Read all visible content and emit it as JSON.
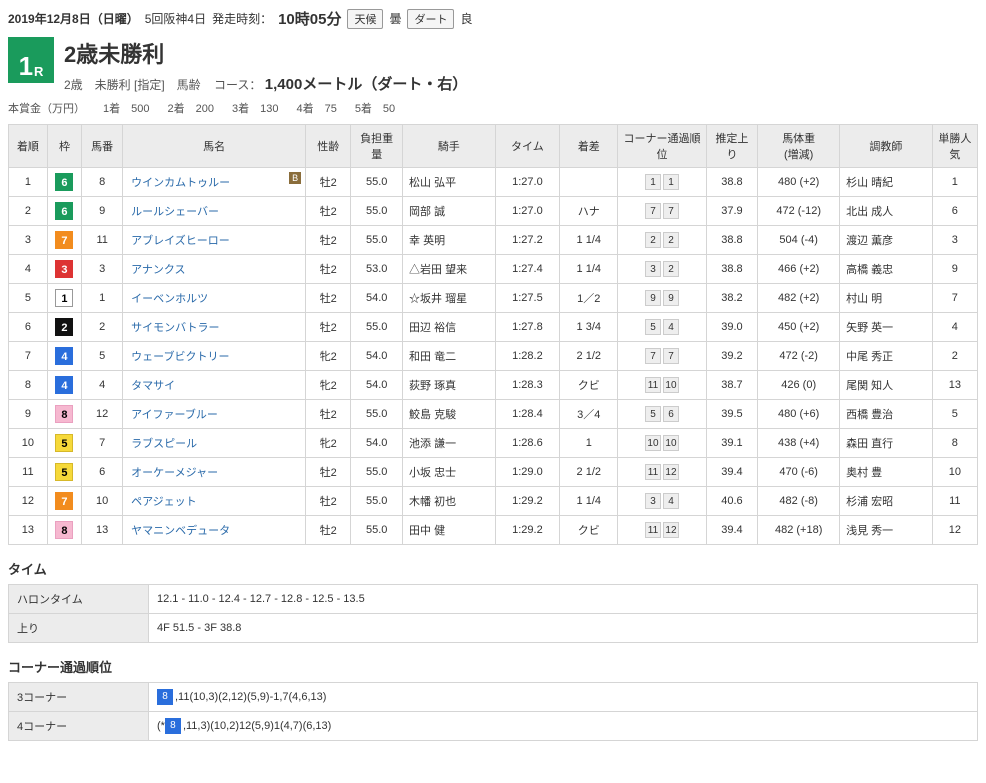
{
  "header": {
    "date": "2019年12月8日（日曜）",
    "venue": "5回阪神4日",
    "post_label": "発走時刻：",
    "post_time": "10時05分",
    "weather_label": "天候",
    "weather_value": "曇",
    "track_label": "ダート",
    "track_value": "良"
  },
  "race": {
    "num": "1",
    "num_suffix": "R",
    "title": "2歳未勝利",
    "sub1": "2歳　未勝利 [指定]　馬齢",
    "sub2_label": "コース：",
    "sub2_value": "1,400メートル（ダート・右）"
  },
  "prize": {
    "label": "本賞金（万円）",
    "items": [
      {
        "place": "1着",
        "amount": "500"
      },
      {
        "place": "2着",
        "amount": "200"
      },
      {
        "place": "3着",
        "amount": "130"
      },
      {
        "place": "4着",
        "amount": "75"
      },
      {
        "place": "5着",
        "amount": "50"
      }
    ]
  },
  "columns": [
    "着順",
    "枠",
    "馬番",
    "馬名",
    "性齢",
    "負担重量",
    "騎手",
    "タイム",
    "着差",
    "コーナー通過順位",
    "推定上り",
    "馬体重(増減)",
    "調教師",
    "単勝人気"
  ],
  "rows": [
    {
      "rank": "1",
      "waku": "6",
      "umaban": "8",
      "name": "ウインカムトゥルー",
      "badge": "B",
      "sex": "牡2",
      "weight": "55.0",
      "jockey": "松山 弘平",
      "time": "1:27.0",
      "margin": "",
      "corners": [
        "1",
        "1"
      ],
      "agari": "38.8",
      "hw": "480 (+2)",
      "trainer": "杉山 晴紀",
      "pop": "1"
    },
    {
      "rank": "2",
      "waku": "6",
      "umaban": "9",
      "name": "ルールシェーバー",
      "badge": "",
      "sex": "牡2",
      "weight": "55.0",
      "jockey": "岡部 誠",
      "time": "1:27.0",
      "margin": "ハナ",
      "corners": [
        "7",
        "7"
      ],
      "agari": "37.9",
      "hw": "472 (-12)",
      "trainer": "北出 成人",
      "pop": "6"
    },
    {
      "rank": "3",
      "waku": "7",
      "umaban": "11",
      "name": "アブレイズヒーロー",
      "badge": "",
      "sex": "牡2",
      "weight": "55.0",
      "jockey": "幸 英明",
      "time": "1:27.2",
      "margin": "1 1/4",
      "corners": [
        "2",
        "2"
      ],
      "agari": "38.8",
      "hw": "504 (-4)",
      "trainer": "渡辺 薫彦",
      "pop": "3"
    },
    {
      "rank": "4",
      "waku": "3",
      "umaban": "3",
      "name": "アナンクス",
      "badge": "",
      "sex": "牡2",
      "weight": "53.0",
      "jockey": "△岩田 望来",
      "time": "1:27.4",
      "margin": "1 1/4",
      "corners": [
        "3",
        "2"
      ],
      "agari": "38.8",
      "hw": "466 (+2)",
      "trainer": "高橋 義忠",
      "pop": "9"
    },
    {
      "rank": "5",
      "waku": "1",
      "umaban": "1",
      "name": "イーベンホルツ",
      "badge": "",
      "sex": "牡2",
      "weight": "54.0",
      "jockey": "☆坂井 瑠星",
      "time": "1:27.5",
      "margin": "1／2",
      "corners": [
        "9",
        "9"
      ],
      "agari": "38.2",
      "hw": "482 (+2)",
      "trainer": "村山 明",
      "pop": "7"
    },
    {
      "rank": "6",
      "waku": "2",
      "umaban": "2",
      "name": "サイモンバトラー",
      "badge": "",
      "sex": "牡2",
      "weight": "55.0",
      "jockey": "田辺 裕信",
      "time": "1:27.8",
      "margin": "1 3/4",
      "corners": [
        "5",
        "4"
      ],
      "agari": "39.0",
      "hw": "450 (+2)",
      "trainer": "矢野 英一",
      "pop": "4"
    },
    {
      "rank": "7",
      "waku": "4",
      "umaban": "5",
      "name": "ウェーブビクトリー",
      "badge": "",
      "sex": "牝2",
      "weight": "54.0",
      "jockey": "和田 竜二",
      "time": "1:28.2",
      "margin": "2 1/2",
      "corners": [
        "7",
        "7"
      ],
      "agari": "39.2",
      "hw": "472 (-2)",
      "trainer": "中尾 秀正",
      "pop": "2"
    },
    {
      "rank": "8",
      "waku": "4",
      "umaban": "4",
      "name": "タマサイ",
      "badge": "",
      "sex": "牝2",
      "weight": "54.0",
      "jockey": "荻野 琢真",
      "time": "1:28.3",
      "margin": "クビ",
      "corners": [
        "11",
        "10"
      ],
      "agari": "38.7",
      "hw": "426 (0)",
      "trainer": "尾関 知人",
      "pop": "13"
    },
    {
      "rank": "9",
      "waku": "8",
      "umaban": "12",
      "name": "アイファーブルー",
      "badge": "",
      "sex": "牡2",
      "weight": "55.0",
      "jockey": "鮫島 克駿",
      "time": "1:28.4",
      "margin": "3／4",
      "corners": [
        "5",
        "6"
      ],
      "agari": "39.5",
      "hw": "480 (+6)",
      "trainer": "西橋 豊治",
      "pop": "5"
    },
    {
      "rank": "10",
      "waku": "5",
      "umaban": "7",
      "name": "ラブスピール",
      "badge": "",
      "sex": "牝2",
      "weight": "54.0",
      "jockey": "池添 謙一",
      "time": "1:28.6",
      "margin": "1",
      "corners": [
        "10",
        "10"
      ],
      "agari": "39.1",
      "hw": "438 (+4)",
      "trainer": "森田 直行",
      "pop": "8"
    },
    {
      "rank": "11",
      "waku": "5",
      "umaban": "6",
      "name": "オーケーメジャー",
      "badge": "",
      "sex": "牡2",
      "weight": "55.0",
      "jockey": "小坂 忠士",
      "time": "1:29.0",
      "margin": "2 1/2",
      "corners": [
        "11",
        "12"
      ],
      "agari": "39.4",
      "hw": "470 (-6)",
      "trainer": "奥村 豊",
      "pop": "10"
    },
    {
      "rank": "12",
      "waku": "7",
      "umaban": "10",
      "name": "ペアジェット",
      "badge": "",
      "sex": "牡2",
      "weight": "55.0",
      "jockey": "木幡 初也",
      "time": "1:29.2",
      "margin": "1 1/4",
      "corners": [
        "3",
        "4"
      ],
      "agari": "40.6",
      "hw": "482 (-8)",
      "trainer": "杉浦 宏昭",
      "pop": "11"
    },
    {
      "rank": "13",
      "waku": "8",
      "umaban": "13",
      "name": "ヤマニンベデュータ",
      "badge": "",
      "sex": "牡2",
      "weight": "55.0",
      "jockey": "田中 健",
      "time": "1:29.2",
      "margin": "クビ",
      "corners": [
        "11",
        "12"
      ],
      "agari": "39.4",
      "hw": "482 (+18)",
      "trainer": "浅見 秀一",
      "pop": "12"
    }
  ],
  "time_section": {
    "title": "タイム",
    "rows": [
      {
        "label": "ハロンタイム",
        "value": "12.1 - 11.0 - 12.4 - 12.7 - 12.8 - 12.5 - 13.5"
      },
      {
        "label": "上り",
        "value": "4F 51.5 - 3F 38.8"
      }
    ]
  },
  "corner_section": {
    "title": "コーナー通過順位",
    "rows": [
      {
        "label": "3コーナー",
        "chip": "8",
        "value": ",11(10,3)(2,12)(5,9)-1,7(4,6,13)"
      },
      {
        "label": "4コーナー",
        "prefix": "(*",
        "chip": "8",
        "value": ",11,3)(10,2)12(5,9)1(4,7)(6,13)"
      }
    ]
  }
}
